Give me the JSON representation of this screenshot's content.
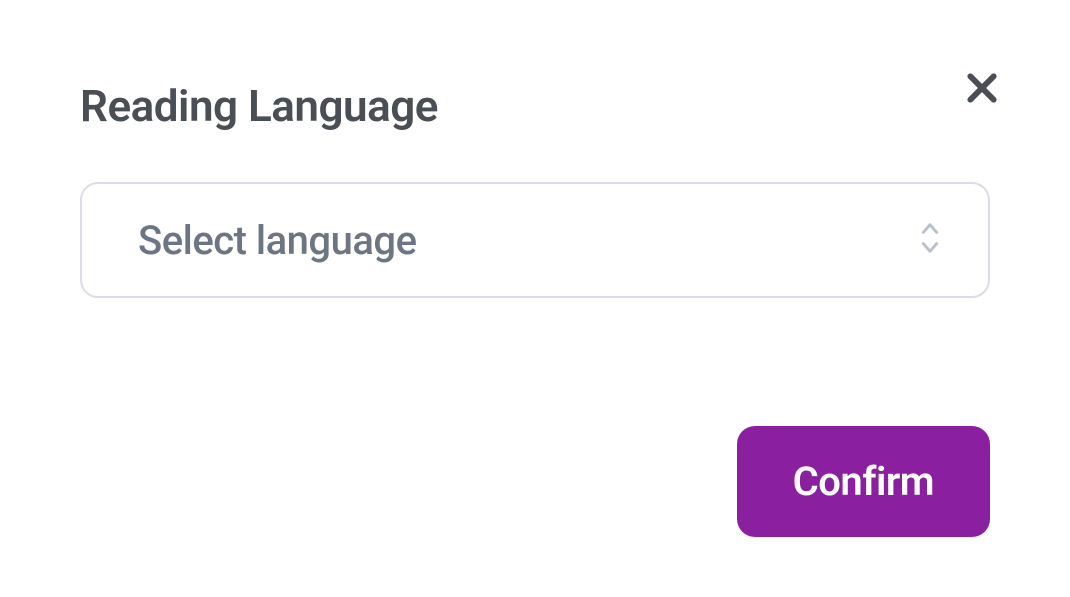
{
  "modal": {
    "title": "Reading Language",
    "select": {
      "placeholder": "Select language"
    },
    "confirm_label": "Confirm"
  },
  "colors": {
    "accent": "#8a1fa0",
    "text_primary": "#4a4e55",
    "text_muted": "#6b7584",
    "border": "#d8dde6",
    "icon_muted": "#b8c0cc"
  }
}
